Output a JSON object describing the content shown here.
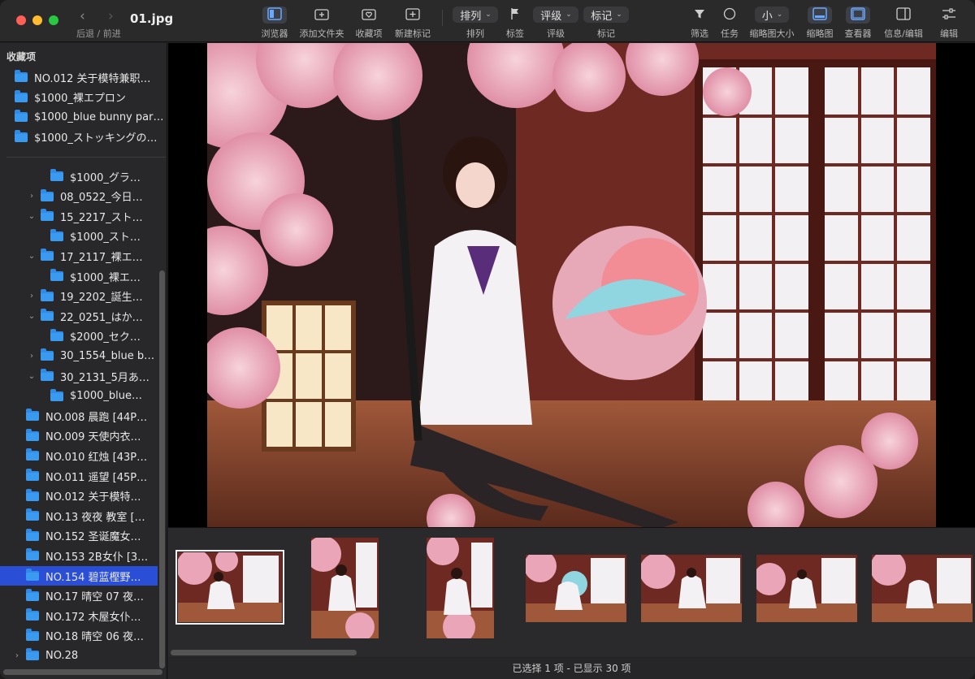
{
  "window": {
    "title": "01.jpg",
    "nav_caption": "后退 / 前进"
  },
  "toolbar": {
    "browser": "浏览器",
    "add_folder": "添加文件夹",
    "favorites": "收藏项",
    "new_tag": "新建标记",
    "sort_pill": "排列",
    "sort_label": "排列",
    "tag_label": "标签",
    "rating_pill": "评级",
    "rating_label": "评级",
    "mark_pill": "标记",
    "mark_label": "标记",
    "filter": "筛选",
    "tasks": "任务",
    "thumb_size_pill": "小",
    "thumb_size_label": "缩略图大小",
    "thumbnails": "缩略图",
    "viewer": "查看器",
    "info_edit": "信息/编辑",
    "edit": "编辑"
  },
  "sidebar": {
    "favorites_header": "收藏项",
    "favorites": [
      "NO.012 关于模特兼职…",
      "$1000_裸エプロン",
      "$1000_blue bunny part…",
      "$1000_ストッキングの…"
    ],
    "tree": [
      {
        "label": "$1000_グラ…",
        "level": 2,
        "disclosure": ""
      },
      {
        "label": "08_0522_今日…",
        "level": 1,
        "disclosure": "›"
      },
      {
        "label": "15_2217_スト…",
        "level": 1,
        "disclosure": "⌄"
      },
      {
        "label": "$1000_スト…",
        "level": 2,
        "disclosure": ""
      },
      {
        "label": "17_2117_裸エ…",
        "level": 1,
        "disclosure": "⌄"
      },
      {
        "label": "$1000_裸エ…",
        "level": 2,
        "disclosure": ""
      },
      {
        "label": "19_2202_誕生…",
        "level": 1,
        "disclosure": "›"
      },
      {
        "label": "22_0251_はか…",
        "level": 1,
        "disclosure": "⌄"
      },
      {
        "label": "$2000_セク…",
        "level": 2,
        "disclosure": ""
      },
      {
        "label": "30_1554_blue b…",
        "level": 1,
        "disclosure": "›"
      },
      {
        "label": "30_2131_5月あ…",
        "level": 1,
        "disclosure": "⌄"
      },
      {
        "label": "$1000_blue…",
        "level": 2,
        "disclosure": ""
      },
      {
        "label": "NO.008 晨跑 [44P…",
        "level": 0,
        "disclosure": ""
      },
      {
        "label": "NO.009 天使内衣…",
        "level": 0,
        "disclosure": ""
      },
      {
        "label": "NO.010 红烛 [43P…",
        "level": 0,
        "disclosure": ""
      },
      {
        "label": "NO.011 遥望 [45P…",
        "level": 0,
        "disclosure": ""
      },
      {
        "label": "NO.012 关于模特…",
        "level": 0,
        "disclosure": ""
      },
      {
        "label": "NO.13 夜夜 教室 […",
        "level": 0,
        "disclosure": ""
      },
      {
        "label": "NO.152 圣诞魔女…",
        "level": 0,
        "disclosure": ""
      },
      {
        "label": "NO.153 2B女仆 [3…",
        "level": 0,
        "disclosure": ""
      },
      {
        "label": "NO.154 碧蓝樫野…",
        "level": 0,
        "disclosure": "",
        "selected": true
      },
      {
        "label": "NO.17 晴空 07 夜…",
        "level": 0,
        "disclosure": ""
      },
      {
        "label": "NO.172 木屋女仆…",
        "level": 0,
        "disclosure": ""
      },
      {
        "label": "NO.18 晴空 06 夜…",
        "level": 0,
        "disclosure": ""
      },
      {
        "label": "NO.28",
        "level": 0,
        "disclosure": "›"
      }
    ]
  },
  "status": {
    "text": "已选择 1 项 - 已显示 30 项"
  },
  "colors": {
    "accent_selection": "#2a4fd6",
    "folder_blue": "#2f8be6"
  }
}
